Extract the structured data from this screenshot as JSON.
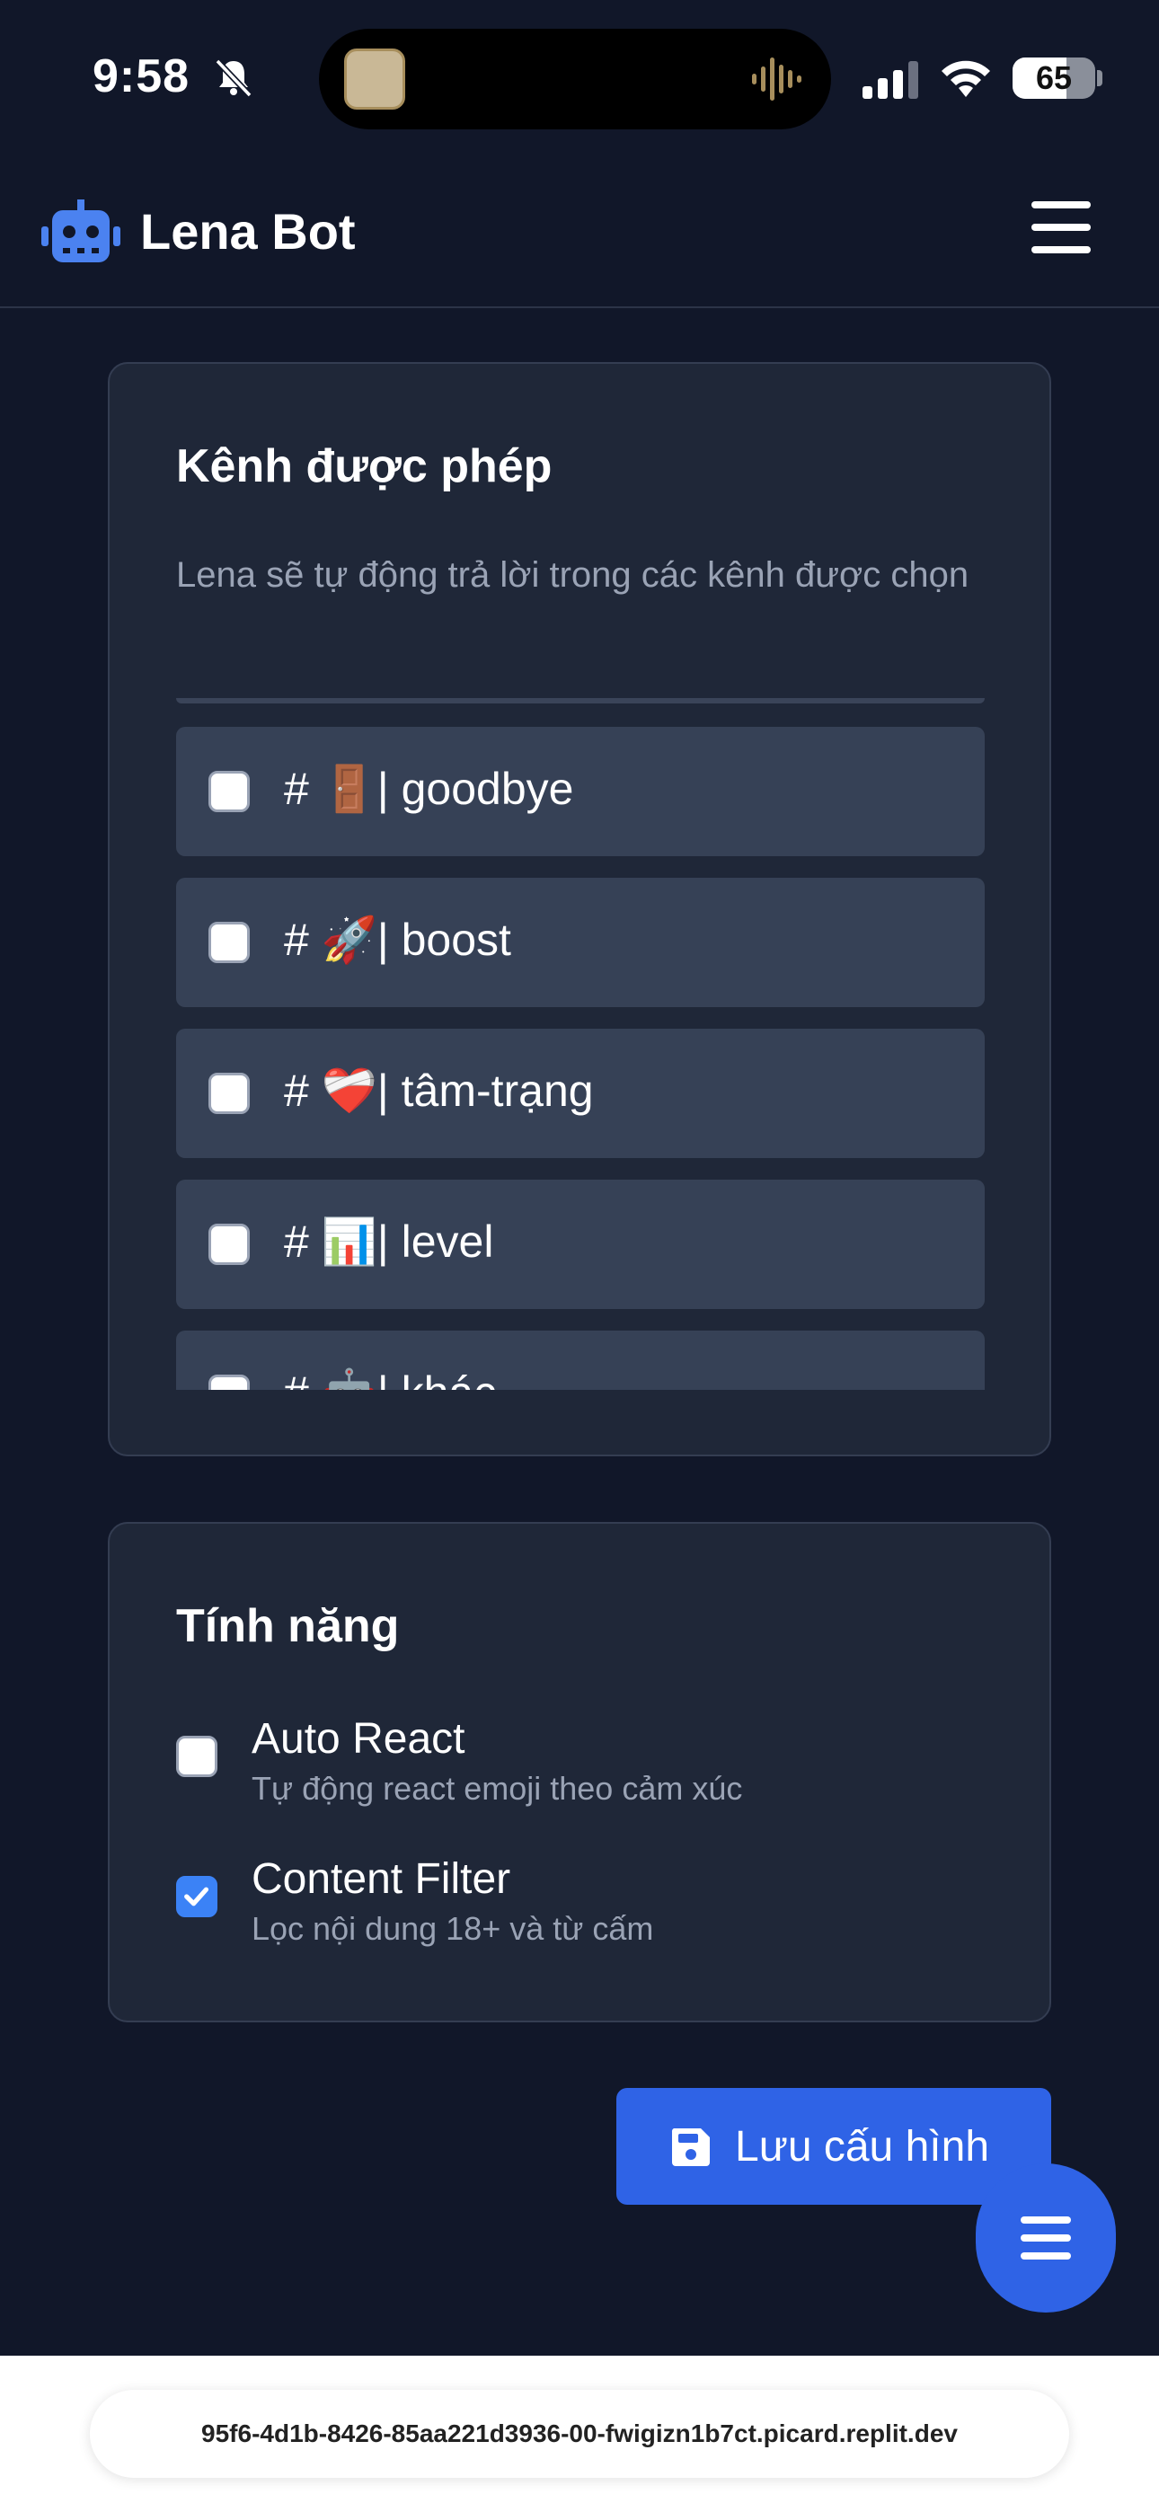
{
  "status_bar": {
    "time": "9:58",
    "battery": "65",
    "battery_level": 0.65,
    "icons": [
      "bell-slash-icon",
      "cellular-signal-icon",
      "wifi-icon",
      "battery-icon"
    ]
  },
  "navbar": {
    "brand_name": "Lena Bot",
    "brand_icon": "robot-icon",
    "brand_color": "#4b82f0",
    "menu_icon": "hamburger-menu-icon"
  },
  "channels_card": {
    "title": "Kênh được phép",
    "description": "Lena sẽ tự động trả lời trong các kênh được chọn",
    "channels": [
      {
        "prefix": "#",
        "emoji": "🚪",
        "separator": "|",
        "name": "goodbye",
        "checked": false
      },
      {
        "prefix": "#",
        "emoji": "🚀",
        "separator": "|",
        "name": "boost",
        "checked": false
      },
      {
        "prefix": "#",
        "emoji": "❤️‍🩹",
        "separator": "|",
        "name": "tâm-trạng",
        "checked": false
      },
      {
        "prefix": "#",
        "emoji": "📊",
        "separator": "|",
        "name": "level",
        "checked": false
      },
      {
        "prefix": "#",
        "emoji": "🤖",
        "separator": "|",
        "name": "khác",
        "checked": false
      }
    ]
  },
  "features_card": {
    "title": "Tính năng",
    "features": [
      {
        "title": "Auto React",
        "subtitle": "Tự động react emoji theo cảm xúc",
        "checked": false
      },
      {
        "title": "Content Filter",
        "subtitle": "Lọc nội dung 18+ và từ cấm",
        "checked": true
      }
    ]
  },
  "save_button": {
    "label": "Lưu cấu hình",
    "icon": "floppy-disk-icon"
  },
  "fab": {
    "icon": "hamburger-menu-icon"
  },
  "browser": {
    "url": "95f6-4d1b-8426-85aa221d3936-00-fwigizn1b7ct.picard.replit.dev"
  },
  "colors": {
    "background": "#111729",
    "card": "#1f2738",
    "channel_item": "#364156",
    "accent": "#2f63e6",
    "checkbox_checked": "#3b82f6"
  }
}
